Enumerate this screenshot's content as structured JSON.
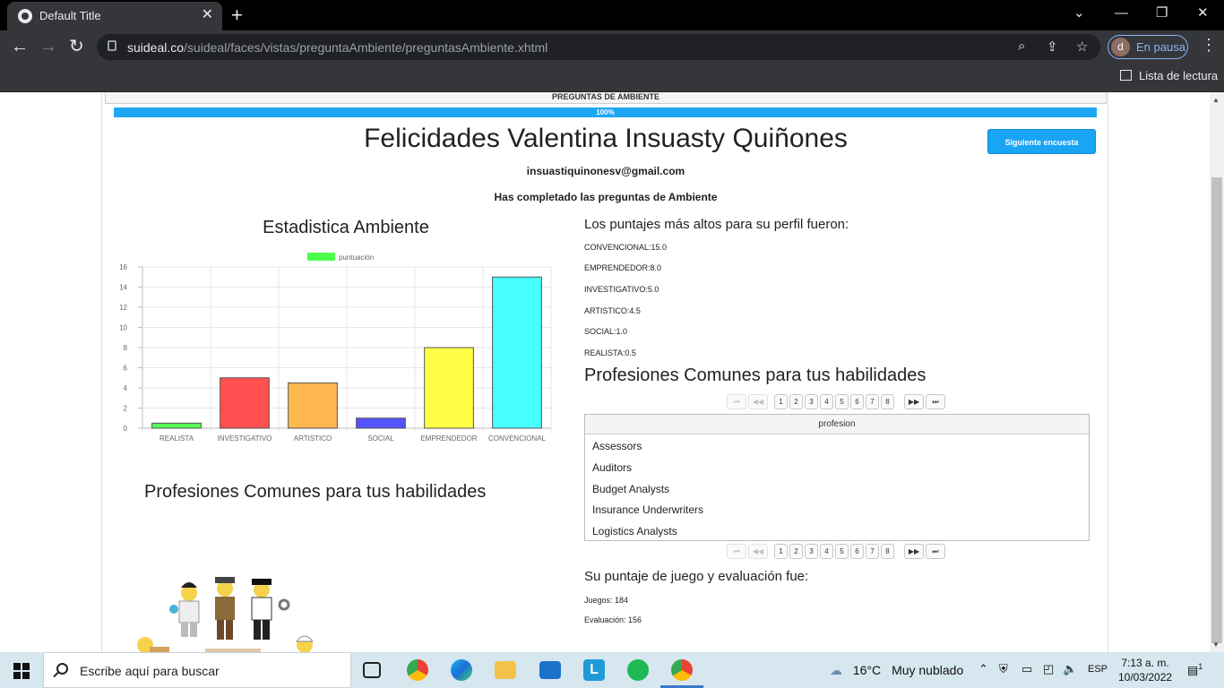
{
  "browser": {
    "tab_title": "Default Title",
    "url_domain": "suideal.co",
    "url_path": "/suideal/faces/vistas/preguntaAmbiente/preguntasAmbiente.xhtml",
    "profile_initial": "d",
    "profile_status": "En pausa",
    "reading_list": "Lista de lectura"
  },
  "page": {
    "header": "PREGUNTAS DE AMBIENTE",
    "progress": "100%",
    "progress_value": 100,
    "congrats": "Felicidades Valentina Insuasty Quiñones",
    "next_button": "Siguiente encuesta",
    "email": "insuastiquinonesv@gmail.com",
    "completed": "Has completado las preguntas de Ambiente",
    "chart_title": "Estadistica Ambiente",
    "profs_left_title": "Profesiones Comunes para tus habilidades",
    "top_scores_title": "Los puntajes más altos para su perfil fueron:",
    "scores": [
      "CONVENCIONAL:15.0",
      "EMPRENDEDOR:8.0",
      "INVESTIGATIVO:5.0",
      "ARTISTICO:4.5",
      "SOCIAL:1.0",
      "REALISTA:0.5"
    ],
    "profs_right_title": "Profesiones Comunes para tus habilidades",
    "pager_pages": [
      "1",
      "2",
      "3",
      "4",
      "5",
      "6",
      "7",
      "8"
    ],
    "pager_first": "⏮",
    "pager_prev": "◀◀",
    "pager_next": "▶▶",
    "pager_last": "⏭",
    "table_header": "profesion",
    "table_rows": [
      "Assessors",
      "Auditors",
      "Budget Analysts",
      "Insurance Underwriters",
      "Logistics Analysts"
    ],
    "game_title": "Su puntaje de juego y evaluación fue:",
    "games": "Juegos: 184",
    "evaluation": "Evaluación: 156"
  },
  "chart_data": {
    "type": "bar",
    "categories": [
      "REALISTA",
      "INVESTIGATIVO",
      "ARTISTICO",
      "SOCIAL",
      "EMPRENDEDOR",
      "CONVENCIONAL"
    ],
    "series": [
      {
        "name": "puntuación",
        "values": [
          0.5,
          5,
          4.5,
          1,
          8,
          15
        ]
      }
    ],
    "colors": [
      "#4cff4c",
      "#ff4646",
      "#ffb347",
      "#4a4aff",
      "#ffff3c",
      "#3cffff"
    ],
    "legend_color": "#4cff4c",
    "yticks": [
      0,
      2,
      4,
      6,
      8,
      10,
      12,
      14,
      16
    ],
    "ylim": [
      0,
      16
    ],
    "grid": true,
    "legend": "top"
  },
  "taskbar": {
    "search_placeholder": "Escribe aquí para buscar",
    "temperature": "16°C",
    "weather": "Muy nublado",
    "lang": "ESP",
    "time": "7:13 a. m.",
    "date": "10/03/2022",
    "notifications": "1"
  }
}
